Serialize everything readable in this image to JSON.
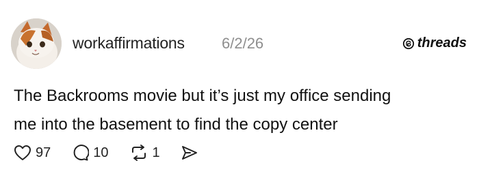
{
  "post": {
    "username": "workaffirmations",
    "timestamp": "6/2/26",
    "brand": "threads",
    "text_lines": [
      "The Backrooms movie but it’s just my office sending",
      "me into the basement to find the copy center"
    ],
    "actions": {
      "likes": "97",
      "replies": "10",
      "reposts": "1"
    }
  },
  "icons": [
    "cat-avatar",
    "threads-logo-icon",
    "heart-icon",
    "comment-icon",
    "repost-icon",
    "share-icon"
  ]
}
